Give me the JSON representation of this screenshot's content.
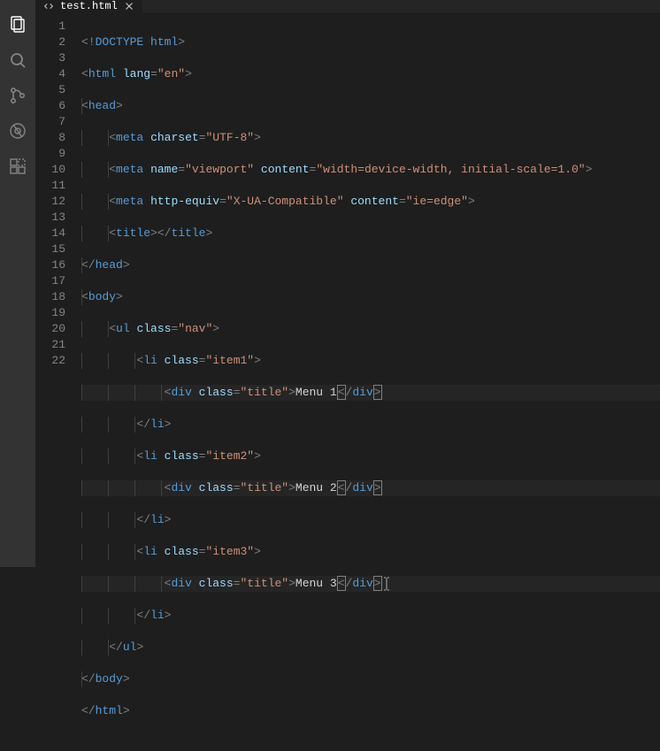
{
  "tab": {
    "filename": "test.html"
  },
  "activity": {
    "explorer": "explorer-icon",
    "search": "search-icon",
    "scm": "source-control-icon",
    "debug": "debug-icon",
    "extensions": "extensions-icon"
  },
  "line_numbers": [
    "1",
    "2",
    "3",
    "4",
    "5",
    "6",
    "7",
    "8",
    "9",
    "10",
    "11",
    "12",
    "13",
    "14",
    "15",
    "16",
    "17",
    "18",
    "19",
    "20",
    "21",
    "22"
  ],
  "code": {
    "doctype": "DOCTYPE html",
    "html_tag": "html",
    "html_lang_attr": "lang",
    "html_lang_val": "\"en\"",
    "head_tag": "head",
    "meta_tag": "meta",
    "charset_attr": "charset",
    "charset_val": "\"UTF-8\"",
    "name_attr": "name",
    "viewport_val": "\"viewport\"",
    "content_attr": "content",
    "viewport_content_val": "\"width=device-width, initial-scale=1.0\"",
    "httpequiv_attr": "http-equiv",
    "httpequiv_val": "\"X-UA-Compatible\"",
    "iecontent_val": "\"ie=edge\"",
    "title_tag": "title",
    "body_tag": "body",
    "ul_tag": "ul",
    "li_tag": "li",
    "div_tag": "div",
    "class_attr": "class",
    "class_nav": "\"nav\"",
    "class_item1": "\"item1\"",
    "class_item2": "\"item2\"",
    "class_item3": "\"item3\"",
    "class_title": "\"title\"",
    "menu1": "Menu 1",
    "menu2": "Menu 2",
    "menu3": "Menu 3"
  }
}
